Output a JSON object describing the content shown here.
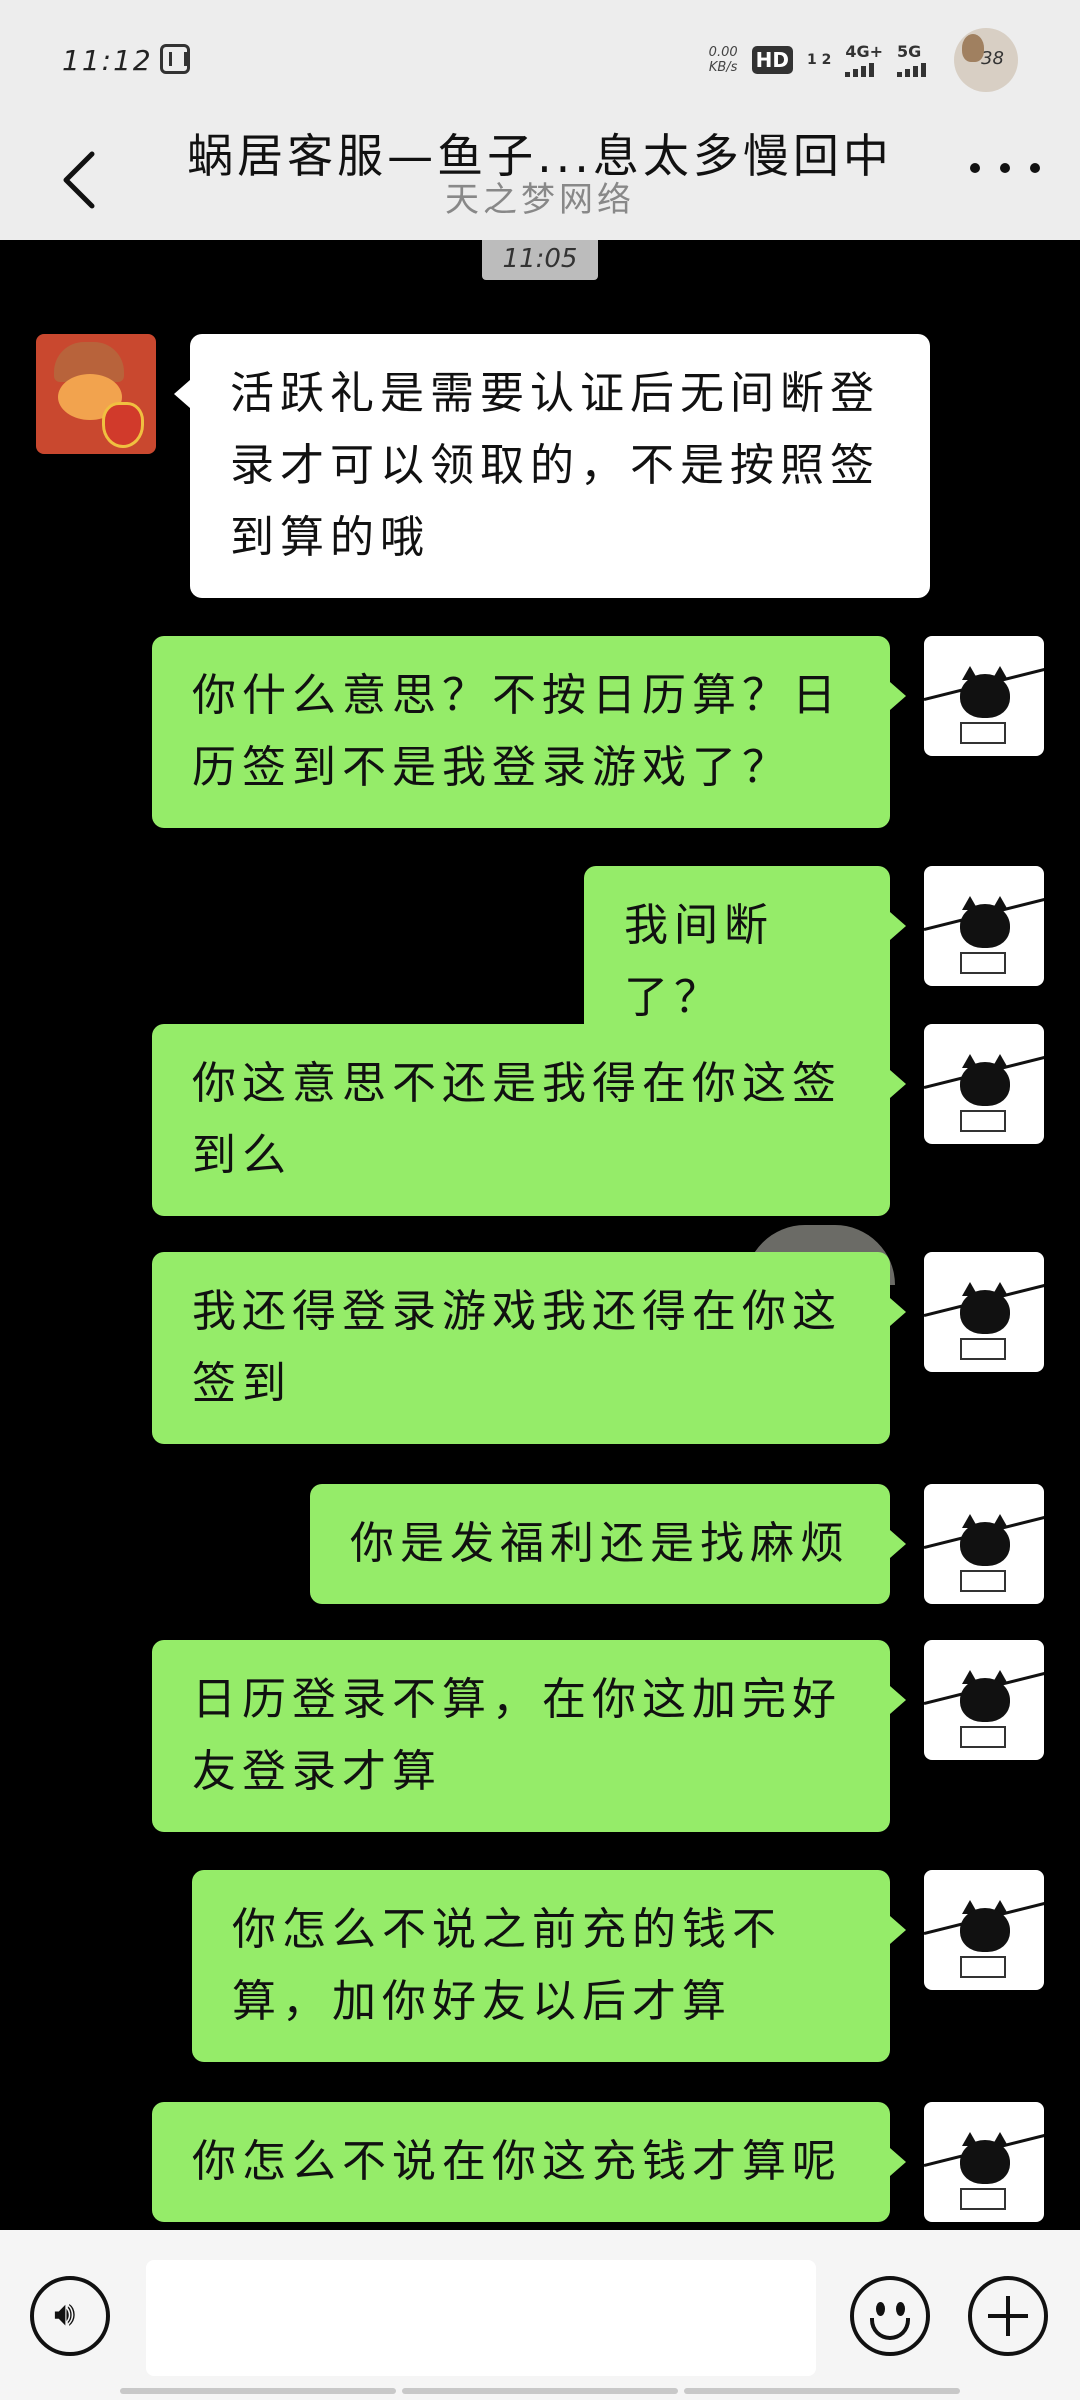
{
  "status_bar": {
    "time": "11:12",
    "net_speed_top": "0.00",
    "net_speed_bottom": "KB/s",
    "hd_label": "HD",
    "hd_sub": "1 2",
    "net1": "4G+",
    "net2": "5G",
    "battery": "38"
  },
  "header": {
    "title": "蜗居客服—鱼子...息太多慢回中",
    "subtitle": "天之梦网络"
  },
  "timestamp": "11:05",
  "messages": [
    {
      "sender": "contact",
      "text": "活跃礼是需要认证后无间断登录才可以领取的，不是按照签到算的哦"
    },
    {
      "sender": "me",
      "text": "你什么意思？不按日历算？日历签到不是我登录游戏了？"
    },
    {
      "sender": "me",
      "text": "我间断了？"
    },
    {
      "sender": "me",
      "text": "你这意思不还是我得在你这签到么"
    },
    {
      "sender": "me",
      "text": "我还得登录游戏我还得在你这签到"
    },
    {
      "sender": "me",
      "text": "你是发福利还是找麻烦"
    },
    {
      "sender": "me",
      "text": "日历登录不算，在你这加完好友登录才算"
    },
    {
      "sender": "me",
      "text": "你怎么不说之前充的钱不算，加你好友以后才算"
    },
    {
      "sender": "me",
      "text": "你怎么不说在你这充钱才算呢"
    }
  ],
  "input_bar": {
    "voice_icon": "voice-icon",
    "emoji_icon": "emoji-icon",
    "plus_icon": "plus-icon",
    "input_value": ""
  },
  "colors": {
    "incoming_bubble": "#ffffff",
    "outgoing_bubble": "#95ec69",
    "header_bg": "#ededed",
    "chat_bg": "#000000"
  }
}
